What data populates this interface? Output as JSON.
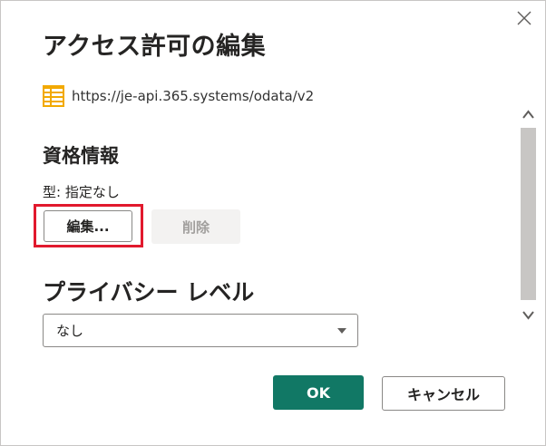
{
  "dialog": {
    "title": "アクセス許可の編集",
    "close_icon": "close-icon"
  },
  "source": {
    "icon": "odata-feed-icon",
    "url": "https://je-api.365.systems/odata/v2"
  },
  "credentials": {
    "heading": "資格情報",
    "type_text": "型: 指定なし",
    "edit_label": "編集...",
    "delete_label": "削除",
    "highlight_color": "#e1192d"
  },
  "privacy": {
    "heading": "プライバシー レベル",
    "selected": "なし"
  },
  "scrollbar": {
    "up_icon": "chevron-up-icon",
    "down_icon": "chevron-down-icon"
  },
  "footer": {
    "ok_label": "OK",
    "cancel_label": "キャンセル",
    "accent_color": "#117865"
  }
}
